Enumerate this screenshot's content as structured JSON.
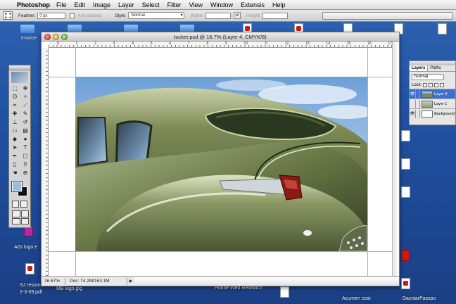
{
  "menubar": {
    "app": "Photoshop",
    "items": [
      "File",
      "Edit",
      "Image",
      "Layer",
      "Select",
      "Filter",
      "View",
      "Window",
      "Extensis",
      "Help"
    ]
  },
  "options": {
    "feather_label": "Feather:",
    "feather_value": "0 px",
    "antialiased_label": "Anti-aliased",
    "style_label": "Style:",
    "style_value": "Normal",
    "width_label": "Width:",
    "height_label": "Height:"
  },
  "document": {
    "title": "tucker.psd @ 16.7% (Layer 4, CMYK/8)",
    "zoom": "16.67%",
    "doc_size": "Doc: 74.2M/163.1M",
    "ruler_numbers": [
      "0",
      "1",
      "2",
      "3",
      "4",
      "5",
      "6",
      "7",
      "8",
      "9",
      "10",
      "11",
      "12",
      "13",
      "14",
      "15",
      "16",
      "17"
    ]
  },
  "layers_panel": {
    "tabs": [
      "Layers",
      "Paths"
    ],
    "blend_mode": "Normal",
    "lock_label": "Lock:",
    "layers": [
      {
        "name": "Layer 4",
        "selected": true
      },
      {
        "name": "Layer 1",
        "selected": false
      },
      {
        "name": "Background",
        "selected": false
      }
    ]
  },
  "desktop": {
    "icons": [
      {
        "label": "Invoice"
      },
      {
        "label": "AGI logo.e"
      },
      {
        "label": "SJ resume"
      },
      {
        "label": "2-3-09.pdf"
      },
      {
        "label": "MB logo.jpg"
      },
      {
        "label": "Prairie Web Research"
      },
      {
        "label": "Acumen cost-"
      },
      {
        "label": "DaystarPasspo"
      }
    ]
  },
  "colors": {
    "desktop": "#2f63b3",
    "selected_layer": "#3d6fd1",
    "foreground_swatch": "#9bbde0",
    "background_swatch": "#111111"
  }
}
